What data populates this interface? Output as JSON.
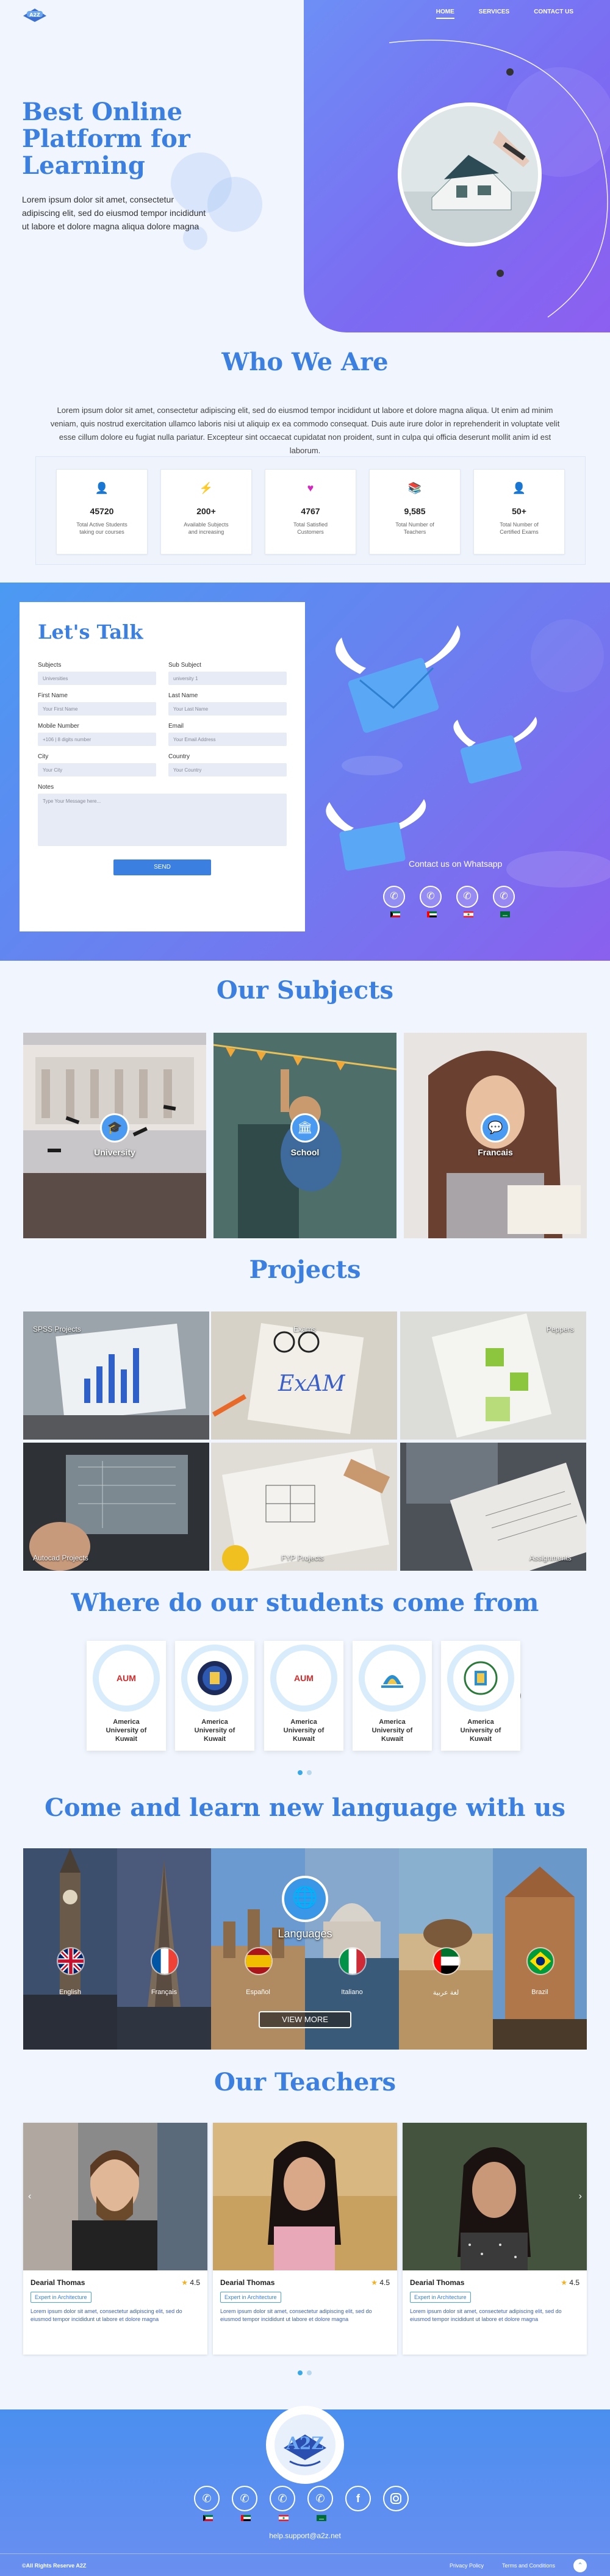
{
  "nav": {
    "items": [
      "HOME",
      "SERVICES",
      "CONTACT US"
    ]
  },
  "hero": {
    "title": "Best Online Platform for Learning",
    "text": "Lorem ipsum dolor sit amet, consectetur adipiscing elit, sed do eiusmod tempor incididunt ut labore et dolore magna aliqua dolore magna"
  },
  "who": {
    "title": "Who We Are",
    "text": "Lorem ipsum dolor sit amet, consectetur adipiscing elit, sed do eiusmod tempor incididunt ut labore et dolore magna aliqua. Ut enim ad minim veniam, quis nostrud exercitation ullamco laboris nisi ut aliquip ex ea commodo consequat. Duis aute irure dolor in reprehenderit in voluptate velit esse cillum dolore eu fugiat nulla pariatur. Excepteur sint occaecat cupidatat non proident, sunt in culpa qui officia deserunt mollit anim id est laborum.",
    "stats": [
      {
        "number": "45720",
        "label": "Total Active Students taking our courses",
        "icon": "user-icon",
        "color": "#3a96e6"
      },
      {
        "number": "200+",
        "label": "Available Subjects and increasing",
        "icon": "lightning-icon",
        "color": "#6a5ae0"
      },
      {
        "number": "4767",
        "label": "Total Satisfied Customers",
        "icon": "heart-icon",
        "color": "#d428c0"
      },
      {
        "number": "9,585",
        "label": "Total Number of Teachers",
        "icon": "book-icon",
        "color": "#3a50c0"
      },
      {
        "number": "50+",
        "label": "Total Number of Certified Exams",
        "icon": "user-icon",
        "color": "#3a96e6"
      }
    ]
  },
  "talk": {
    "title": "Let's Talk",
    "subjects_label": "Subjects",
    "subjects_value": "Universities",
    "subsubject_label": "Sub Subject",
    "subsubject_value": "university 1",
    "first_label": "First Name",
    "first_ph": "Your First Name",
    "last_label": "Last Name",
    "last_ph": "Your Last Name",
    "mobile_label": "Mobile Number",
    "mobile_ph": "+106 | 8 digits number",
    "email_label": "Email",
    "email_ph": "Your Email Address",
    "city_label": "City",
    "city_ph": "Your City",
    "country_label": "Country",
    "country_ph": "Your Country",
    "notes_label": "Notes",
    "notes_ph": "Type Your Message here...",
    "send": "SEND",
    "whatsapp_title": "Contact us on Whatsapp",
    "whatsapp_countries": [
      "Kuwait",
      "UAE",
      "Lebanon",
      "KSA"
    ]
  },
  "subjects": {
    "title": "Our Subjects",
    "items": [
      {
        "label": "University",
        "icon": "graduation-icon"
      },
      {
        "label": "School",
        "icon": "school-icon"
      },
      {
        "label": "Francais",
        "icon": "chat-icon"
      }
    ]
  },
  "projects": {
    "title": "Projects",
    "items": [
      "SPSS Projects",
      "Exams",
      "Peppers",
      "Autocad Projects",
      "FYP Projects",
      "Assignments"
    ]
  },
  "students": {
    "title": "Where do our students come from",
    "universities": [
      {
        "logo": "AUM",
        "name": "America University of Kuwait"
      },
      {
        "logo": "",
        "name": "America University of Kuwait"
      },
      {
        "logo": "AUM",
        "name": "America University of Kuwait"
      },
      {
        "logo": "",
        "name": "America University of Kuwait"
      },
      {
        "logo": "",
        "name": "America University of Kuwait"
      }
    ]
  },
  "languages": {
    "title": "Come and learn new language with us",
    "label": "Languages",
    "items": [
      "English",
      "Français",
      "Español",
      "Italiano",
      "لغة عربية",
      "Brazil"
    ],
    "view_more": "VIEW MORE"
  },
  "teachers": {
    "title": "Our Teachers",
    "items": [
      {
        "name": "Dearial Thomas",
        "rating": "4.5",
        "tag": "Expert in Architecture",
        "desc": "Lorem ipsum dolor sit amet, consectetur adipiscing elit, sed do eiusmod tempor incididunt ut labore et dolore magna"
      },
      {
        "name": "Dearial Thomas",
        "rating": "4.5",
        "tag": "Expert in Architecture",
        "desc": "Lorem ipsum dolor sit amet, consectetur adipiscing elit, sed do eiusmod tempor incididunt ut labore et dolore magna"
      },
      {
        "name": "Dearial Thomas",
        "rating": "4.5",
        "tag": "Expert in Architecture",
        "desc": "Lorem ipsum dolor sit amet, consectetur adipiscing elit, sed do eiusmod tempor incididunt ut labore et dolore magna"
      }
    ]
  },
  "footer": {
    "email": "help.support@a2z.net",
    "copyright": "©All Rights Reserve A2Z",
    "privacy": "Privacy Policy",
    "terms": "Terms and Conditions",
    "countries": [
      "Kuwait",
      "UAE",
      "Lebanon",
      "KSA"
    ]
  }
}
